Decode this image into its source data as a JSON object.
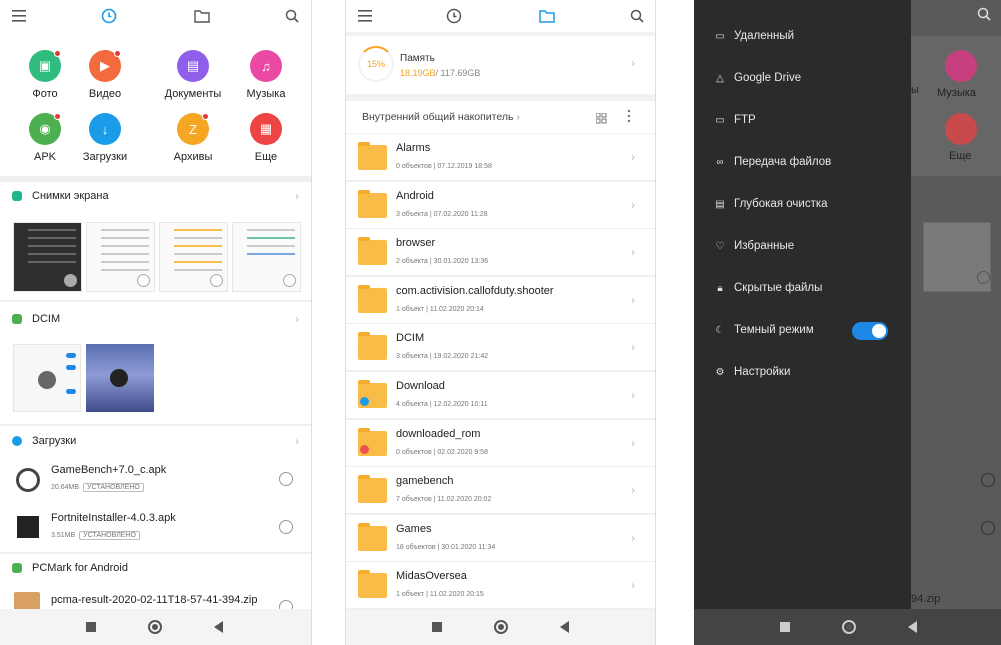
{
  "screen1": {
    "categories": [
      {
        "label": "Фото",
        "color": "#2ebd7e",
        "icon": "photo-icon",
        "dot": true
      },
      {
        "label": "Видео",
        "color": "#f26a3d",
        "icon": "video-icon",
        "dot": true
      },
      {
        "label": "Документы",
        "color": "#8e5fe8",
        "icon": "document-icon",
        "dot": false
      },
      {
        "label": "Музыка",
        "color": "#ea4aa3",
        "icon": "music-icon",
        "dot": false
      },
      {
        "label": "APK",
        "color": "#4caf50",
        "icon": "android-icon",
        "dot": true
      },
      {
        "label": "Загрузки",
        "color": "#1a9ce8",
        "icon": "download-icon",
        "dot": false
      },
      {
        "label": "Архивы",
        "color": "#f5a623",
        "icon": "zip-icon",
        "dot": true
      },
      {
        "label": "Еще",
        "color": "#ef4444",
        "icon": "grid-icon",
        "dot": false
      }
    ],
    "sections": {
      "screenshots": {
        "title": "Снимки экрана",
        "color": "#1fb58a"
      },
      "dcim": {
        "title": "DCIM",
        "color": "#4caf50"
      },
      "downloads": {
        "title": "Загрузки",
        "color": "#1a9ce8"
      },
      "pcmark": {
        "title": "PCMark for Android",
        "color": "#4caf50"
      }
    },
    "files": [
      {
        "name": "GameBench+7.0_c.apk",
        "size": "20.64MB",
        "badge": "УСТАНОВЛЕНО"
      },
      {
        "name": "FortniteInstaller-4.0.3.apk",
        "size": "3.51MB",
        "badge": "УСТАНОВЛЕНО"
      }
    ],
    "pcmark_file": "pcma-result-2020-02-11T18-57-41-394.zip"
  },
  "screen2": {
    "storage": {
      "percent": "15%",
      "label": "Память",
      "used": "18.19GB",
      "total": "/ 117.69GB"
    },
    "location": "Внутренний общий накопитель",
    "folders": [
      {
        "name": "Alarms",
        "meta": "0 объектов  |  07.12.2019 18:58",
        "badge": ""
      },
      {
        "name": "Android",
        "meta": "3 объекта  |  07.02.2020 11:28",
        "badge": ""
      },
      {
        "name": "browser",
        "meta": "2 объекта  |  30.01.2020 13:36",
        "badge": ""
      },
      {
        "name": "com.activision.callofduty.shooter",
        "meta": "1 объект  |  11.02.2020 20:14",
        "badge": ""
      },
      {
        "name": "DCIM",
        "meta": "3 объекта  |  19.02.2020 21:42",
        "badge": ""
      },
      {
        "name": "Download",
        "meta": "4 объекта  |  12.02.2020 10:11",
        "badge": "#1a9ce8"
      },
      {
        "name": "downloaded_rom",
        "meta": "0 объектов  |  02.02.2020 9:58",
        "badge": "#ef5350"
      },
      {
        "name": "gamebench",
        "meta": "7 объектов  |  11.02.2020 20:02",
        "badge": ""
      },
      {
        "name": "Games",
        "meta": "18 объектов  |  30.01.2020 11:34",
        "badge": ""
      },
      {
        "name": "MidasOversea",
        "meta": "1 объект  |  11.02.2020 20:15",
        "badge": ""
      }
    ]
  },
  "screen3": {
    "drawer_items": [
      {
        "label": "Удаленный",
        "icon": "remote-icon"
      },
      {
        "label": "Google Drive",
        "icon": "google-drive-icon"
      },
      {
        "label": "FTP",
        "icon": "ftp-icon"
      },
      {
        "label": "Передача файлов",
        "icon": "file-transfer-icon"
      },
      {
        "label": "Глубокая очистка",
        "icon": "deep-clean-icon"
      },
      {
        "label": "Избранные",
        "icon": "heart-icon"
      },
      {
        "label": "Скрытые файлы",
        "icon": "lock-icon"
      },
      {
        "label": "Темный режим",
        "icon": "moon-icon"
      },
      {
        "label": "Настройки",
        "icon": "settings-icon"
      }
    ],
    "dark_mode_on": true,
    "bg_labels": {
      "music": "Музыка",
      "more": "Еще",
      "partial": "ы",
      "zip": "94.zip"
    }
  }
}
